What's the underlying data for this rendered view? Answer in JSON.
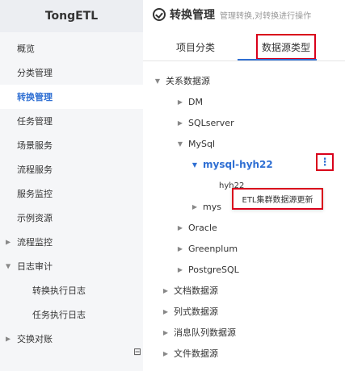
{
  "app": {
    "title": "TongETL"
  },
  "sidebar": {
    "items": [
      {
        "label": "概览"
      },
      {
        "label": "分类管理"
      },
      {
        "label": "转换管理"
      },
      {
        "label": "任务管理"
      },
      {
        "label": "场景服务"
      },
      {
        "label": "流程服务"
      },
      {
        "label": "服务监控"
      },
      {
        "label": "示例资源"
      },
      {
        "label": "流程监控"
      },
      {
        "label": "日志审计"
      },
      {
        "label": "转换执行日志"
      },
      {
        "label": "任务执行日志"
      },
      {
        "label": "交换对账"
      }
    ],
    "collapse_icon": "⊟"
  },
  "header": {
    "title": "转换管理",
    "subtitle": "管理转换,对转换进行操作"
  },
  "tabs": [
    {
      "label": "项目分类"
    },
    {
      "label": "数据源类型"
    }
  ],
  "tree": {
    "root1": "关系数据源",
    "dm": "DM",
    "sqlserver": "SQLserver",
    "mysql": "MySql",
    "mysql_hyh22": "mysql-hyh22",
    "hyh22_child": "hyh22",
    "mysql_other": "mys",
    "oracle": "Oracle",
    "greenplum": "Greenplum",
    "postgresql": "PostgreSQL",
    "doc": "文档数据源",
    "column": "列式数据源",
    "mq": "消息队列数据源",
    "file": "文件数据源"
  },
  "popup": {
    "label": "ETL集群数据源更新"
  },
  "colors": {
    "accent": "#2f6fd3",
    "highlight_border": "#d9001b"
  }
}
